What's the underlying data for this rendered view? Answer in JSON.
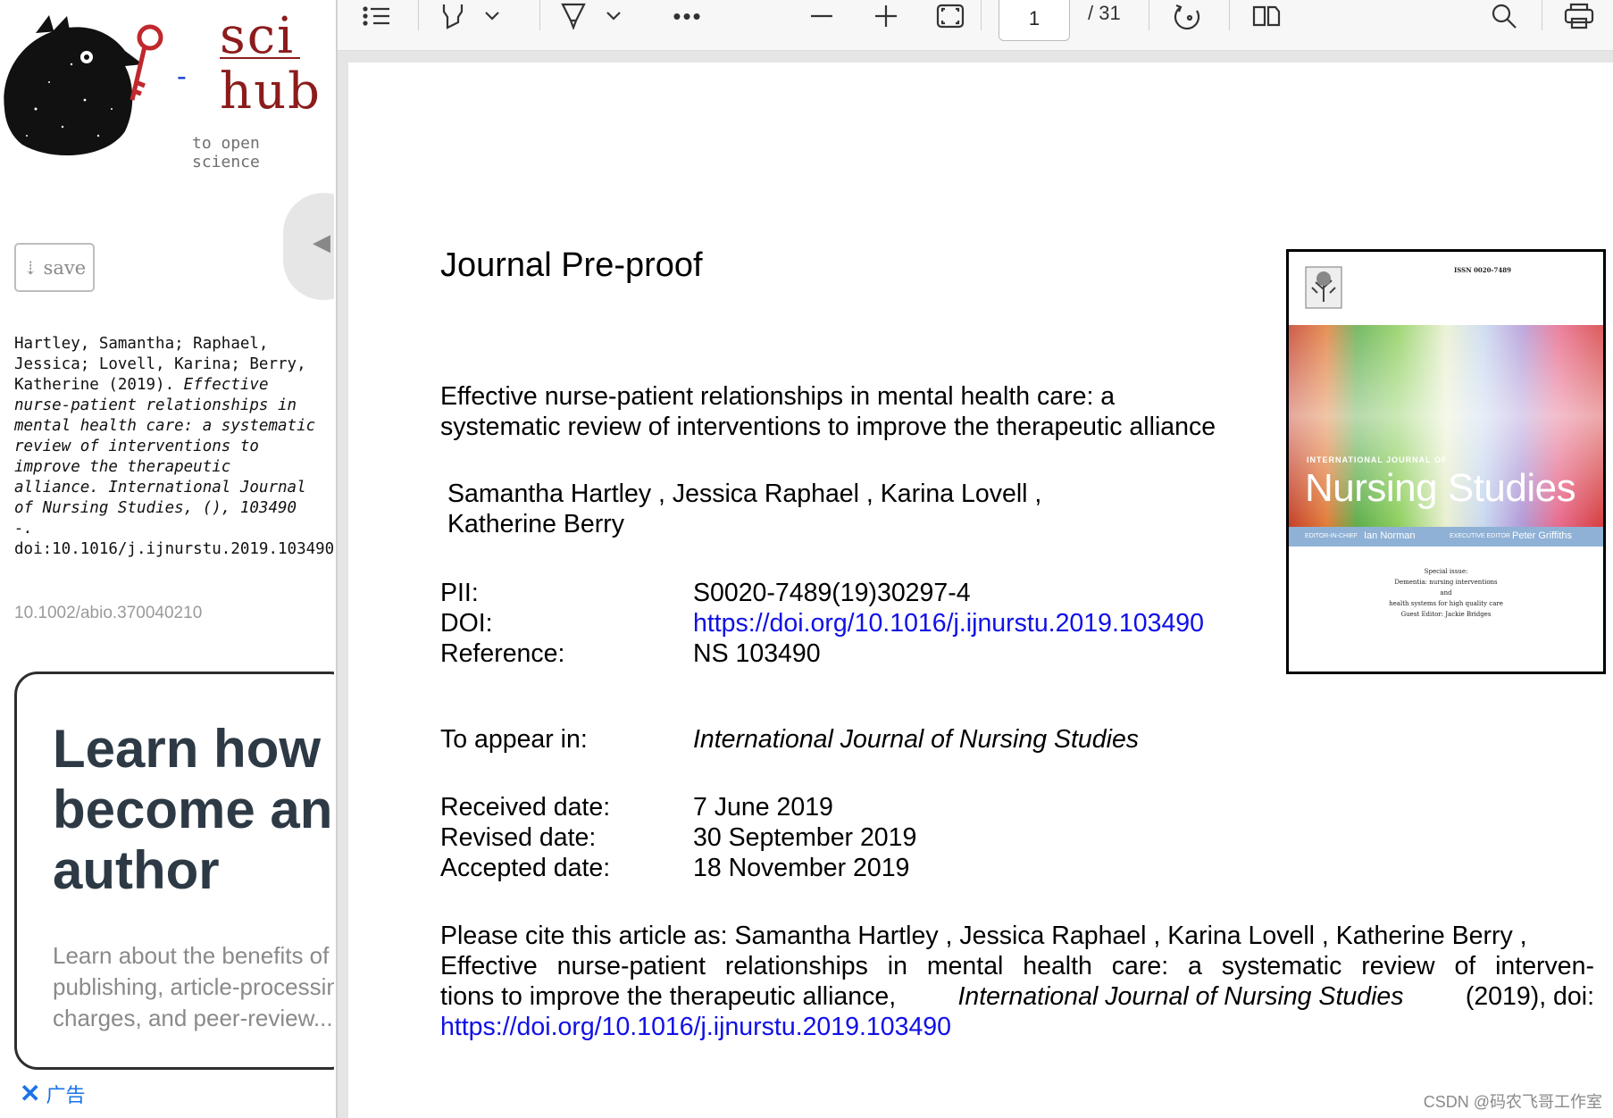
{
  "sidebar": {
    "logo": {
      "left": "sci",
      "right": "hub",
      "dash": "-",
      "tagline": "to open science"
    },
    "save_label": "save",
    "save_icon": "download-arrow-icon",
    "citation": {
      "authors_year": "Hartley, Samantha; Raphael, Jessica; Lovell, Karina; Berry, Katherine (2019).",
      "title_journal": "Effective nurse-patient relationships in mental health care: a systematic review of interventions to improve the therapeutic alliance. International Journal of Nursing Studies, (), 103490 -.",
      "doi": "doi:10.1016/j.ijnurstu.2019.103490"
    },
    "doi_small": "10.1002/abio.370040210",
    "ad": {
      "heading": "Learn how\nbecome an\nauthor",
      "body": "Learn about the benefits of\npublishing, article-processin\ncharges, and peer-review...",
      "label": "广告"
    }
  },
  "toolbar": {
    "page_current": "1",
    "page_total": "/ 31",
    "icons": [
      "contents-list-icon",
      "highlight-icon",
      "chevron-down-icon",
      "draw-icon",
      "chevron-down-icon",
      "more-icon",
      "zoom-out-icon",
      "zoom-in-icon",
      "fit-page-icon",
      "rotate-icon",
      "two-page-icon",
      "search-icon",
      "print-icon"
    ]
  },
  "document": {
    "pre_proof": "Journal Pre-proof",
    "title_line1": "Effective nurse-patient relationships in mental health care: a",
    "title_line2": "systematic review of interventions to improve the therapeutic alliance",
    "authors_line1": "Samantha Hartley ,  Jessica Raphael ,  Karina Lovell ,",
    "authors_line2": "Katherine Berry",
    "meta": [
      {
        "label": "PII:",
        "value": "S0020-7489(19)30297-4"
      },
      {
        "label": "DOI:",
        "value": "https://doi.org/10.1016/j.ijnurstu.2019.103490"
      },
      {
        "label": "Reference:",
        "value": "NS 103490"
      }
    ],
    "appear_label": "To appear in:",
    "appear_value": "International Journal of Nursing Studies",
    "dates": [
      {
        "label": "Received date:",
        "value": "7 June 2019"
      },
      {
        "label": "Revised date:",
        "value": "30 September 2019"
      },
      {
        "label": "Accepted date:",
        "value": "18 November 2019"
      }
    ],
    "cite_line1": "Please cite this article as:  Samantha Hartley ,  Jessica Raphael ,  Karina Lovell ,  Katherine Berry ,",
    "cite_line2": "Effective nurse-patient relationships in mental health care: a systematic review of interven-",
    "cite_line3_start": "tions to improve the therapeutic alliance,",
    "cite_line3_journal": "International Journal of Nursing Studies",
    "cite_line3_end": "(2019), doi:",
    "cite_link": "https://doi.org/10.1016/j.ijnurstu.2019.103490",
    "cover": {
      "issn": "ISSN 0020-7489",
      "journal_small": "INTERNATIONAL JOURNAL OF",
      "journal": "Nursing Studies",
      "editor_label": "EDITOR-IN-CHIEF",
      "editor": "Ian Norman",
      "exec_label": "EXECUTIVE EDITOR",
      "exec": "Peter Griffiths",
      "special": "Special issue:\nDementia: nursing interventions\nand\nhealth systems for high quality care\nGuest Editor: Jackie Bridges"
    }
  },
  "watermark": "CSDN @码农飞哥工作室"
}
